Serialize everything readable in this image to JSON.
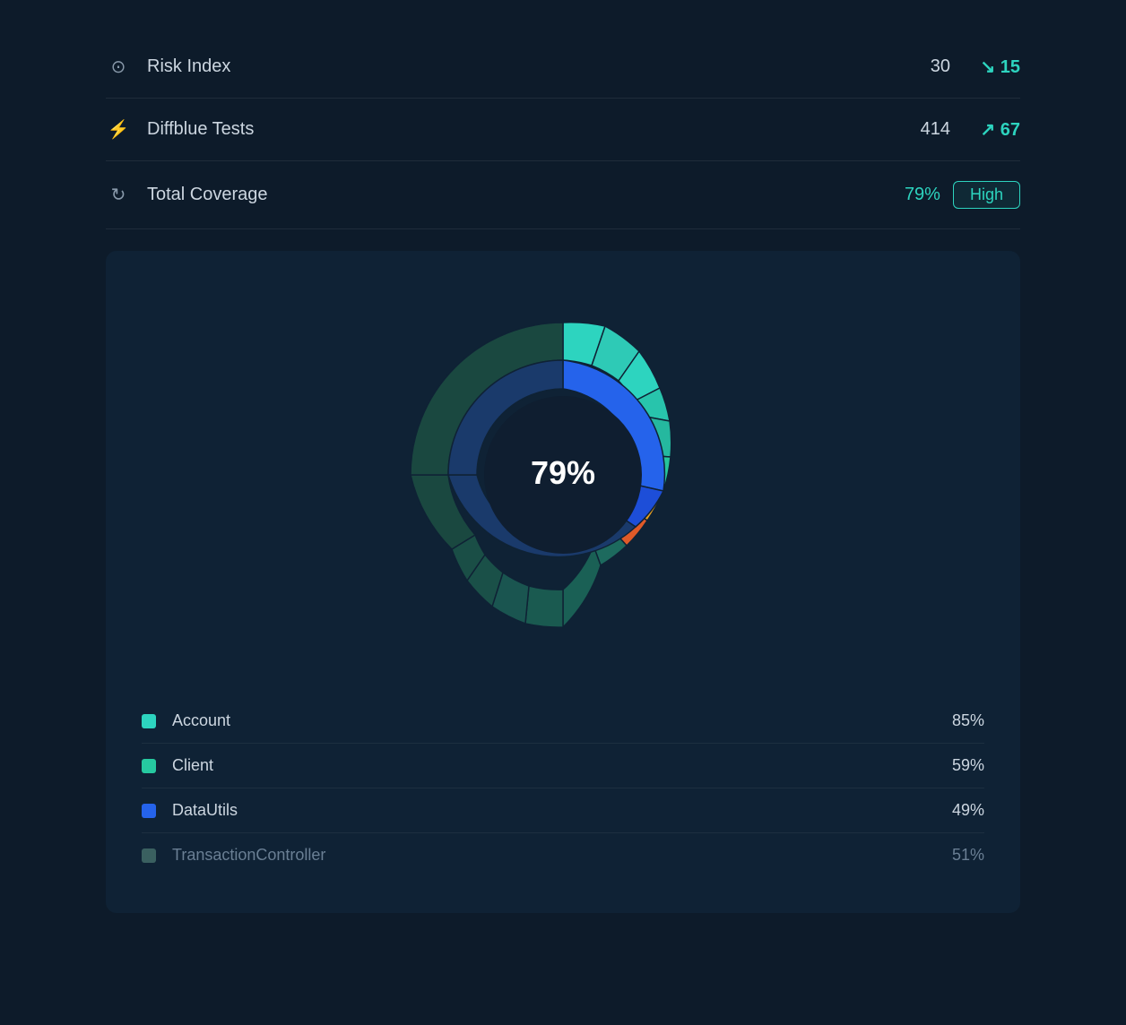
{
  "metrics": {
    "risk_index": {
      "label": "Risk Index",
      "value": "30",
      "change": "↘ 15",
      "change_direction": "down"
    },
    "diffblue_tests": {
      "label": "Diffblue Tests",
      "value": "414",
      "change": "↗ 67",
      "change_direction": "up"
    },
    "total_coverage": {
      "label": "Total Coverage",
      "percentage": "79%",
      "badge": "High"
    }
  },
  "donut": {
    "center_label": "79%",
    "segments_outer": [
      {
        "color": "#2dd4bf",
        "startAngle": -90,
        "endAngle": 20,
        "label": "Account-outer"
      },
      {
        "color": "#26a99a",
        "startAngle": 20,
        "endAngle": 60,
        "label": "Client-outer"
      },
      {
        "color": "#e8a020",
        "startAngle": 60,
        "endAngle": 82,
        "label": "Yellow-outer"
      },
      {
        "color": "#e05a28",
        "startAngle": 82,
        "endAngle": 100,
        "label": "Orange-outer"
      },
      {
        "color": "#1d5a52",
        "startAngle": 100,
        "endAngle": 270,
        "label": "Dark-outer"
      }
    ],
    "segments_inner": [
      {
        "color": "#2563eb",
        "startAngle": -90,
        "endAngle": 60,
        "label": "Blue-inner"
      },
      {
        "color": "#1d4ed8",
        "startAngle": 60,
        "endAngle": 80,
        "label": "Blue-inner2"
      },
      {
        "color": "#1a3a6b",
        "startAngle": 80,
        "endAngle": 270,
        "label": "Dark-blue-inner"
      }
    ]
  },
  "legend": [
    {
      "name": "Account",
      "color": "#2dd4bf",
      "percentage": "85%",
      "muted": false
    },
    {
      "name": "Client",
      "color": "#26c9a0",
      "percentage": "59%",
      "muted": false
    },
    {
      "name": "DataUtils",
      "color": "#2563eb",
      "percentage": "49%",
      "muted": false
    },
    {
      "name": "TransactionController",
      "color": "#3a6060",
      "percentage": "51%",
      "muted": true
    }
  ]
}
